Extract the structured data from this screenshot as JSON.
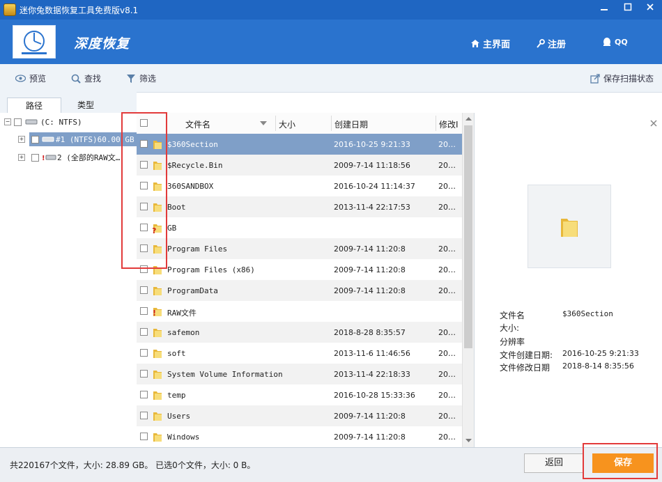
{
  "window": {
    "title": "迷你兔数据恢复工具免费版v8.1"
  },
  "header": {
    "logo_text": "深度恢复",
    "home": "主界面",
    "register": "注册",
    "qq": "QQ"
  },
  "toolbar": {
    "preview": "预览",
    "find": "查找",
    "filter": "筛选",
    "save_scan": "保存扫描状态"
  },
  "tabs": {
    "path": "路径",
    "type": "类型"
  },
  "tree": {
    "root": "(C: NTFS)",
    "item1": "#1 (NTFS)60.00 GB",
    "item2": "2 (全部的RAW文…"
  },
  "file_list": {
    "columns": {
      "name": "文件名",
      "size": "大小",
      "created": "创建日期",
      "modified": "修改I"
    },
    "rows": [
      {
        "name": "$360Section",
        "created": "2016-10-25 9:21:33",
        "modified": "20…",
        "icon": "folder-icon"
      },
      {
        "name": "$Recycle.Bin",
        "created": "2009-7-14 11:18:56",
        "modified": "20…",
        "icon": "folder-icon"
      },
      {
        "name": "360SANDBOX",
        "created": "2016-10-24 11:14:37",
        "modified": "20…",
        "icon": "folder-icon"
      },
      {
        "name": "Boot",
        "created": "2013-11-4 22:17:53",
        "modified": "20…",
        "icon": "folder-icon"
      },
      {
        "name": "GB",
        "created": "",
        "modified": "",
        "icon": "unknown-folder-icon"
      },
      {
        "name": "Program Files",
        "created": "2009-7-14 11:20:8",
        "modified": "20…",
        "icon": "folder-icon"
      },
      {
        "name": "Program Files (x86)",
        "created": "2009-7-14 11:20:8",
        "modified": "20…",
        "icon": "folder-icon"
      },
      {
        "name": "ProgramData",
        "created": "2009-7-14 11:20:8",
        "modified": "20…",
        "icon": "folder-icon"
      },
      {
        "name": "RAW文件",
        "created": "",
        "modified": "",
        "icon": "raw-folder-icon"
      },
      {
        "name": "safemon",
        "created": "2018-8-28 8:35:57",
        "modified": "20…",
        "icon": "folder-icon"
      },
      {
        "name": "soft",
        "created": "2013-11-6 11:46:56",
        "modified": "20…",
        "icon": "folder-icon"
      },
      {
        "name": "System Volume Information",
        "created": "2013-11-4 22:18:33",
        "modified": "20…",
        "icon": "folder-icon"
      },
      {
        "name": "temp",
        "created": "2016-10-28 15:33:36",
        "modified": "20…",
        "icon": "folder-icon"
      },
      {
        "name": "Users",
        "created": "2009-7-14 11:20:8",
        "modified": "20…",
        "icon": "folder-icon"
      },
      {
        "name": "Windows",
        "created": "2009-7-14 11:20:8",
        "modified": "20…",
        "icon": "folder-icon"
      }
    ]
  },
  "preview": {
    "labels": {
      "name": "文件名",
      "size": "大小:",
      "resolution": "分辨率",
      "created": "文件创建日期:",
      "modified": "文件修改日期"
    },
    "values": {
      "name": "$360Section",
      "created": "2016-10-25 9:21:33",
      "modified": "2018-8-14 8:35:56"
    }
  },
  "status": {
    "summary": "共220167个文件，大小: 28.89 GB。 已选0个文件，大小: 0 B。",
    "back": "返回",
    "save": "保存"
  },
  "colors": {
    "titlebar": "#1f66c2",
    "header": "#2a73ce",
    "save_button": "#f7931e",
    "selected_row": "#7f9fc8",
    "highlight_box": "#e23a3a"
  }
}
